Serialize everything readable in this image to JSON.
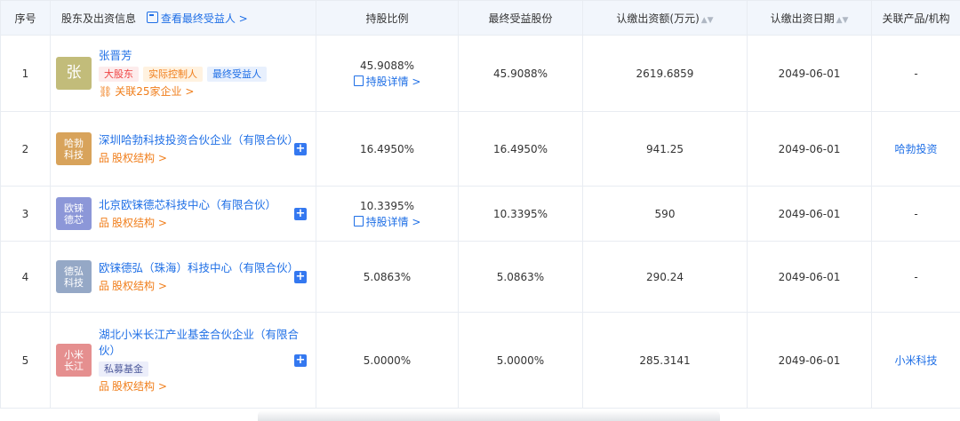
{
  "header": {
    "index": "序号",
    "shareholder": "股东及出资信息",
    "view_beneficiary": "查看最终受益人 >",
    "ratio": "持股比例",
    "final_share": "最终受益股份",
    "subscribed_amount": "认缴出资额(万元)",
    "subscribed_date": "认缴出资日期",
    "related": "关联产品/机构"
  },
  "colors": {
    "link": "#1f6fe6",
    "orange": "#f07e1b",
    "header_bg": "#f2f6fc",
    "plus": "#3478f0"
  },
  "rows": [
    {
      "index": "1",
      "avatar_text": "张",
      "avatar_color": "#c2bc7a",
      "name": "张晋芳",
      "tags": [
        {
          "label": "大股东",
          "style": "red"
        },
        {
          "label": "实际控制人",
          "style": "orange"
        },
        {
          "label": "最终受益人",
          "style": "blue"
        }
      ],
      "sublink": "关联25家企业 >",
      "sublink_icon": "link-icon",
      "ratio": "45.9088%",
      "detail": "持股详情 >",
      "final_share": "45.9088%",
      "amount": "2619.6859",
      "date": "2049-06-01",
      "related": "-"
    },
    {
      "index": "2",
      "avatar_text": "哈勃\n科技",
      "avatar_color": "#d8a35b",
      "name": "深圳哈勃科技投资合伙企业（有限合伙）",
      "tags": [],
      "sublink": "股权结构 >",
      "sublink_icon": "structure-icon",
      "ratio": "16.4950%",
      "detail": "",
      "final_share": "16.4950%",
      "amount": "941.25",
      "date": "2049-06-01",
      "related": "哈勃投资"
    },
    {
      "index": "3",
      "avatar_text": "欧铼\n德芯",
      "avatar_color": "#8c97d8",
      "name": "北京欧铼德芯科技中心（有限合伙）",
      "tags": [],
      "sublink": "股权结构 >",
      "sublink_icon": "structure-icon",
      "ratio": "10.3395%",
      "detail": "持股详情 >",
      "final_share": "10.3395%",
      "amount": "590",
      "date": "2049-06-01",
      "related": "-"
    },
    {
      "index": "4",
      "avatar_text": "德弘\n科技",
      "avatar_color": "#95a8c6",
      "name": "欧铼德弘（珠海）科技中心（有限合伙）",
      "tags": [],
      "sublink": "股权结构 >",
      "sublink_icon": "structure-icon",
      "ratio": "5.0863%",
      "detail": "",
      "final_share": "5.0863%",
      "amount": "290.24",
      "date": "2049-06-01",
      "related": "-"
    },
    {
      "index": "5",
      "avatar_text": "小米\n长江",
      "avatar_color": "#e58f8f",
      "name": "湖北小米长江产业基金合伙企业（有限合伙）",
      "tags": [
        {
          "label": "私募基金",
          "style": "purple"
        }
      ],
      "sublink": "股权结构 >",
      "sublink_icon": "structure-icon",
      "ratio": "5.0000%",
      "detail": "",
      "final_share": "5.0000%",
      "amount": "285.3141",
      "date": "2049-06-01",
      "related": "小米科技"
    }
  ]
}
